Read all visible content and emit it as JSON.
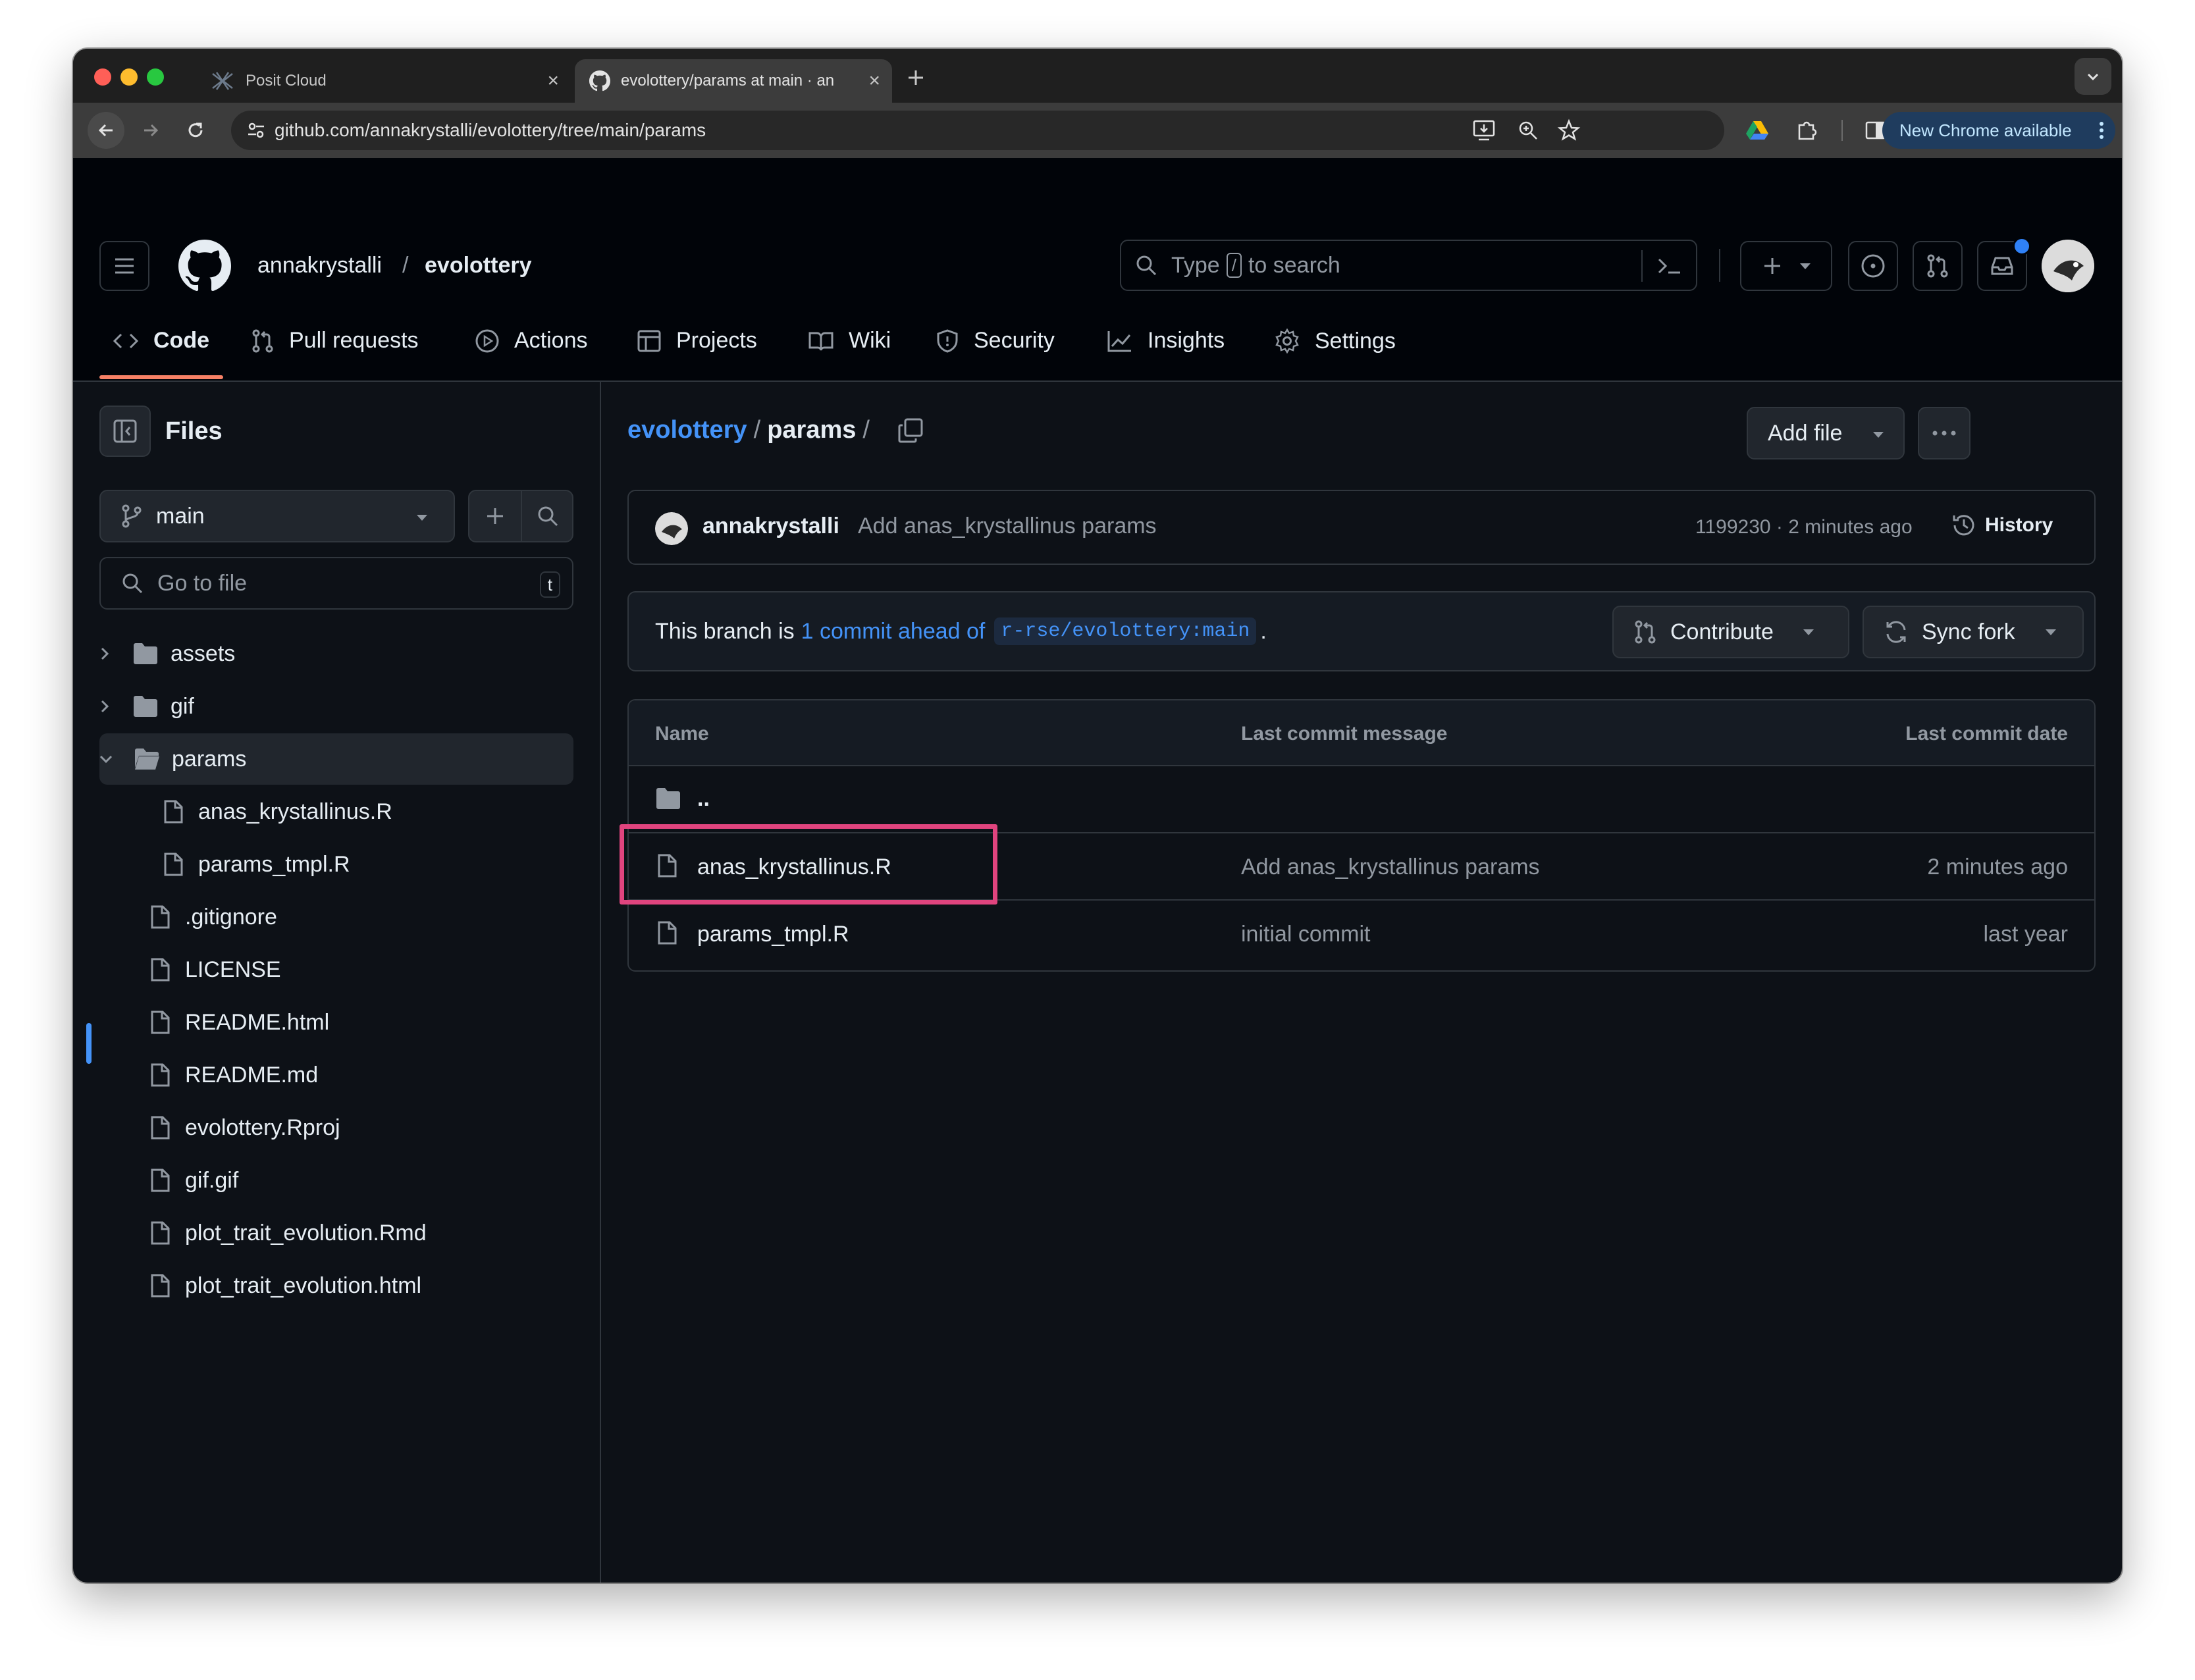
{
  "browser": {
    "tabs": [
      {
        "title": "Posit Cloud",
        "active": false
      },
      {
        "title": "evolottery/params at main · an",
        "active": true
      }
    ],
    "url": "github.com/annakrystalli/evolottery/tree/main/params",
    "update_label": "New Chrome available"
  },
  "header": {
    "owner": "annakrystalli",
    "separator": "/",
    "repo": "evolottery",
    "search": {
      "prefix": "Type",
      "key": "/",
      "suffix": "to search"
    }
  },
  "repo_nav": {
    "tabs": [
      {
        "label": "Code",
        "icon": "code-icon",
        "active": true
      },
      {
        "label": "Pull requests",
        "icon": "git-pull-request-icon"
      },
      {
        "label": "Actions",
        "icon": "play-icon"
      },
      {
        "label": "Projects",
        "icon": "table-icon"
      },
      {
        "label": "Wiki",
        "icon": "book-icon"
      },
      {
        "label": "Security",
        "icon": "shield-icon"
      },
      {
        "label": "Insights",
        "icon": "graph-icon"
      },
      {
        "label": "Settings",
        "icon": "gear-icon"
      }
    ]
  },
  "sidebar": {
    "title": "Files",
    "branch": "main",
    "go_to_file_placeholder": "Go to file",
    "go_to_file_key": "t",
    "tree": [
      {
        "name": "assets",
        "type": "folder",
        "depth": 0,
        "expanded": false
      },
      {
        "name": "gif",
        "type": "folder",
        "depth": 0,
        "expanded": false
      },
      {
        "name": "params",
        "type": "folder",
        "depth": 0,
        "expanded": true,
        "selected": true
      },
      {
        "name": "anas_krystallinus.R",
        "type": "file",
        "depth": 1
      },
      {
        "name": "params_tmpl.R",
        "type": "file",
        "depth": 1
      },
      {
        "name": ".gitignore",
        "type": "file",
        "depth": 0
      },
      {
        "name": "LICENSE",
        "type": "file",
        "depth": 0
      },
      {
        "name": "README.html",
        "type": "file",
        "depth": 0
      },
      {
        "name": "README.md",
        "type": "file",
        "depth": 0
      },
      {
        "name": "evolottery.Rproj",
        "type": "file",
        "depth": 0
      },
      {
        "name": "gif.gif",
        "type": "file",
        "depth": 0
      },
      {
        "name": "plot_trait_evolution.Rmd",
        "type": "file",
        "depth": 0
      },
      {
        "name": "plot_trait_evolution.html",
        "type": "file",
        "depth": 0
      }
    ]
  },
  "main": {
    "breadcrumb": {
      "repo": "evolottery",
      "sep1": "/",
      "folder": "params",
      "sep2": "/"
    },
    "add_file_label": "Add file",
    "latest_commit": {
      "author": "annakrystalli",
      "message": "Add anas_krystallinus params",
      "sha_time": "1199230 · 2 minutes ago",
      "history_label": "History"
    },
    "branch_status": {
      "prefix": "This branch is",
      "ahead_link": "1 commit ahead of",
      "upstream": "r-rse/evolottery:main",
      "suffix": ".",
      "contribute_label": "Contribute",
      "sync_label": "Sync fork"
    },
    "table": {
      "headers": [
        "Name",
        "Last commit message",
        "Last commit date"
      ],
      "parent_dir": "..",
      "rows": [
        {
          "name": "anas_krystallinus.R",
          "message": "Add anas_krystallinus params",
          "date": "2 minutes ago",
          "highlighted": true
        },
        {
          "name": "params_tmpl.R",
          "message": "initial commit",
          "date": "last year",
          "highlighted": false
        }
      ]
    }
  },
  "colors": {
    "accent_link": "#4493f8",
    "tab_underline": "#f78166",
    "highlight_box": "#e0447e",
    "notification_dot": "#2f81f7"
  }
}
